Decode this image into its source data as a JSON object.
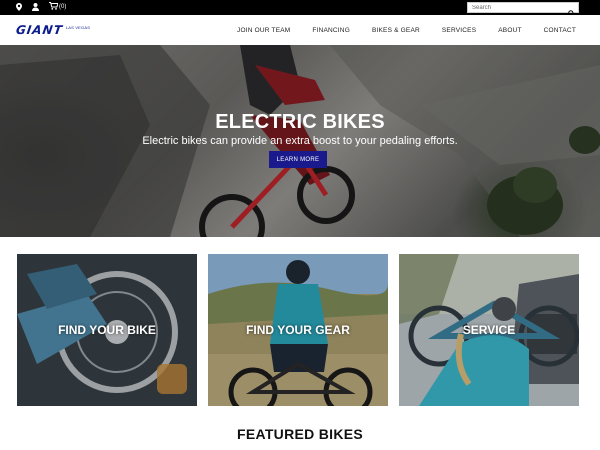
{
  "topbar": {
    "cart_count": "(0)",
    "search_placeholder": "Search"
  },
  "header": {
    "brand": "GIANT",
    "location": "LAS VEGAS",
    "nav": [
      "JOIN OUR TEAM",
      "FINANCING",
      "BIKES & GEAR",
      "SERVICES",
      "ABOUT",
      "CONTACT"
    ]
  },
  "hero": {
    "title": "ELECTRIC BIKES",
    "subtitle": "Electric bikes can provide an extra boost to your pedaling efforts.",
    "button_label": "LEARN MORE"
  },
  "tiles": [
    {
      "label": "FIND YOUR BIKE"
    },
    {
      "label": "FIND YOUR GEAR"
    },
    {
      "label": "SERVICE"
    }
  ],
  "featured": {
    "heading": "FEATURED BIKES"
  },
  "colors": {
    "brand_blue": "#0b1c8c",
    "button_blue": "#1a1a8c",
    "topbar_black": "#000000"
  }
}
